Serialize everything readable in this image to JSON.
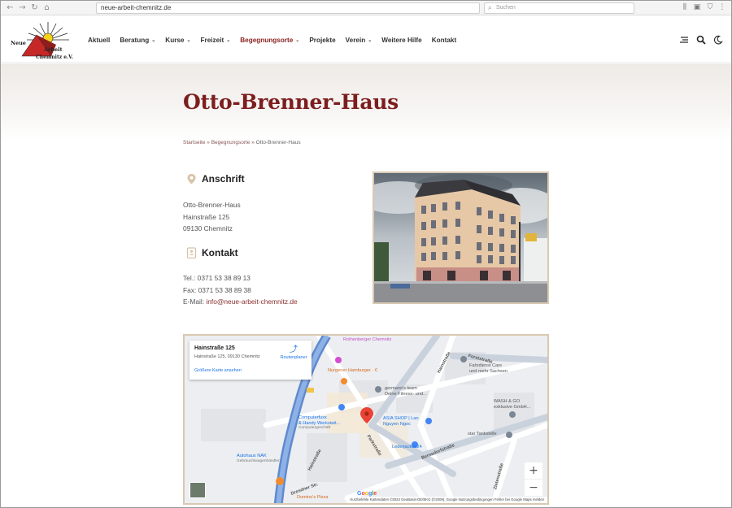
{
  "browser": {
    "url": "neue-arbeit-chemnitz.de",
    "search_placeholder": "Suchen"
  },
  "logo": {
    "line1": "Neue",
    "line2": "Arbeit",
    "line3": "Chemnitz e.V."
  },
  "menu": {
    "items": [
      {
        "label": "Aktuell",
        "has_dropdown": false
      },
      {
        "label": "Beratung",
        "has_dropdown": true
      },
      {
        "label": "Kurse",
        "has_dropdown": true
      },
      {
        "label": "Freizeit",
        "has_dropdown": true
      },
      {
        "label": "Begegnungsorte",
        "has_dropdown": true,
        "active": true
      },
      {
        "label": "Projekte",
        "has_dropdown": false
      },
      {
        "label": "Verein",
        "has_dropdown": true
      },
      {
        "label": "Weitere Hilfe",
        "has_dropdown": false
      },
      {
        "label": "Kontakt",
        "has_dropdown": false
      }
    ],
    "active_color": "#8a1f1f"
  },
  "page": {
    "title": "Otto-Brenner-Haus",
    "breadcrumb": {
      "home": "Startseite",
      "sep1": " » ",
      "parent": "Begegnungsorte",
      "sep2": " » ",
      "current": "Otto-Brenner-Haus"
    }
  },
  "anschrift": {
    "heading": "Anschrift",
    "line1": "Otto-Brenner-Haus",
    "line2": "Hainstraße 125",
    "line3": "09130 Chemnitz"
  },
  "kontakt": {
    "heading": "Kontakt",
    "tel": "Tel.: 0371 53 38 89 13",
    "fax": "Fax: 0371 53 38 89 38",
    "email_label": "E-Mail: ",
    "email": "info@neue-arbeit-chemnitz.de"
  },
  "map": {
    "card_title": "Hainstraße 125",
    "card_address": "Hainstraße 125, 09130 Chemnitz",
    "card_link": "Größere Karte ansehen",
    "route_label": "Routenplaner",
    "zoom_in": "+",
    "zoom_out": "−",
    "google": "Google",
    "attribution": "Kurzbefehle    Kartendaten ©2024 GeoBasis-DE/BKG (©2009), Google    Nutzungsbedingungen    Fehler bei Google Maps melden",
    "pois": {
      "rothenberger": "Rothenberger Chemnitz",
      "nurgener": "Nurgener\nHamburger · €",
      "germano1": "germano's team",
      "germano2": "Deine Fitness- und...",
      "asia1": "ASIA SHOP | Lan",
      "asia2": "Nguyen Ngoc",
      "computer1": "Computerfuxx",
      "computer2": "& Handy Werkstatt...",
      "computer3": "Computergeschäft",
      "lederjacken": "Lederjacken24",
      "autohaus1": "Autohaus NAK",
      "autohaus2": "Gebrauchtwagenhändler",
      "dominos": "Domino's Pizza",
      "fahrdienst1": "Fahrdienst Care",
      "fahrdienst2": "und mehr Sachsen",
      "wash1": "WASH & GO",
      "wash2": "exklusive GmbH...",
      "tank": "star Tankstelle",
      "street_forst": "Forststraße",
      "street_hain1": "Hainstraße",
      "street_hain2": "Hainstraße",
      "street_park": "Parkstraße",
      "street_bern": "Bernsdorfstraße",
      "street_zietz": "Zietenstraße",
      "street_dres": "Dresdner Str."
    }
  }
}
